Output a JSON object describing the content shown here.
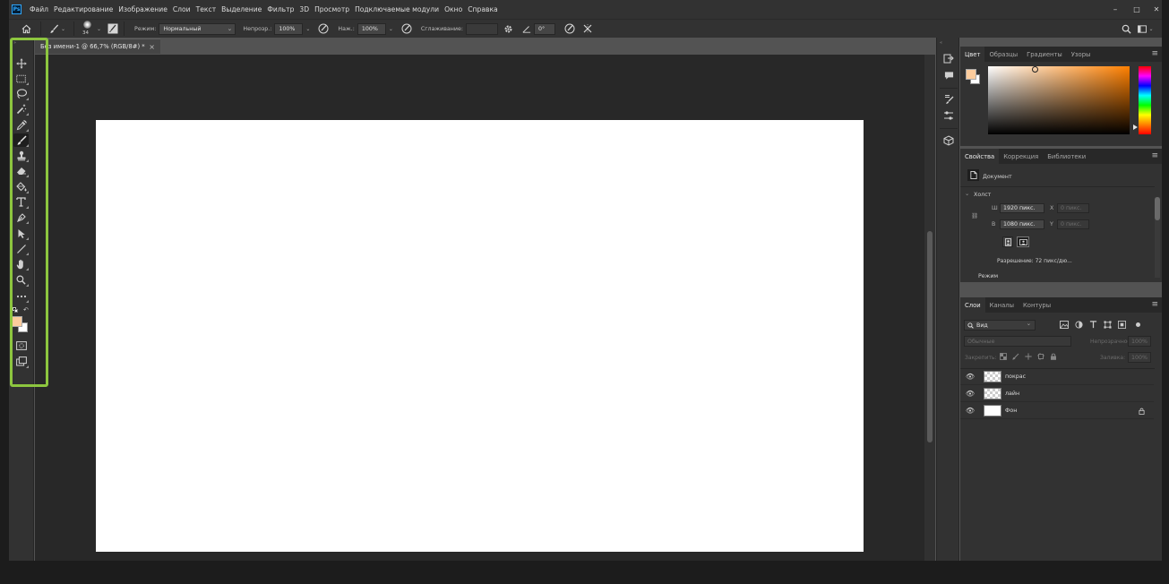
{
  "app": {
    "logo_text": "Ps"
  },
  "menu": [
    "Файл",
    "Редактирование",
    "Изображение",
    "Слои",
    "Текст",
    "Выделение",
    "Фильтр",
    "3D",
    "Просмотр",
    "Подключаемые модули",
    "Окно",
    "Справка"
  ],
  "window_controls": {
    "minimize": "–",
    "maximize": "□",
    "close": "✕"
  },
  "options_bar": {
    "brush_size": "34",
    "mode_label": "Режим:",
    "mode_value": "Нормальный",
    "opacity_label": "Непрозр.:",
    "opacity_value": "100%",
    "flow_label": "Наж.:",
    "flow_value": "100%",
    "smoothing_label": "Сглаживание:",
    "angle_value": "0°"
  },
  "document_tab": {
    "title": "Без имени-1 @ 66,7% (RGB/8#) *",
    "close": "×"
  },
  "toolbar_tools": [
    "move-tool",
    "marquee-tool",
    "lasso-tool",
    "magic-wand-tool",
    "eyedropper-tool",
    "brush-tool",
    "stamp-tool",
    "eraser-tool",
    "paint-bucket-tool",
    "type-tool",
    "pen-tool",
    "path-select-tool",
    "line-tool",
    "hand-tool",
    "zoom-tool",
    "more-tools"
  ],
  "colors": {
    "foreground": "#fccc9d",
    "background": "#ffffff",
    "highlight": "#8dc63f",
    "hue_cursor": "#ff8000"
  },
  "color_panel": {
    "tabs": [
      "Цвет",
      "Образцы",
      "Градиенты",
      "Узоры"
    ],
    "active": 0
  },
  "properties_panel": {
    "tabs": [
      "Свойства",
      "Коррекция",
      "Библиотеки"
    ],
    "active": 0,
    "doc_label": "Документ",
    "section": "Холст",
    "w_label": "Ш",
    "w_value": "1920 пикс.",
    "h_label": "В",
    "h_value": "1080 пикс.",
    "x_label": "X",
    "x_value": "0 пикс.",
    "y_label": "Y",
    "y_value": "0 пикс.",
    "resolution": "Разрешение: 72 пикс/дю...",
    "mode_label": "Режим"
  },
  "layers_panel": {
    "tabs": [
      "Слои",
      "Каналы",
      "Контуры"
    ],
    "active": 0,
    "filter_label": "Вид",
    "blend_mode": "Обычные",
    "opacity_label": "Непрозрачность:",
    "opacity_value": "100%",
    "lock_label": "Закрепить:",
    "fill_label": "Заливка:",
    "fill_value": "100%",
    "layers": [
      {
        "name": "покрас",
        "thumb": "checker"
      },
      {
        "name": "лайн",
        "thumb": "checker"
      },
      {
        "name": "Фон",
        "thumb": "white",
        "locked": true
      }
    ]
  }
}
